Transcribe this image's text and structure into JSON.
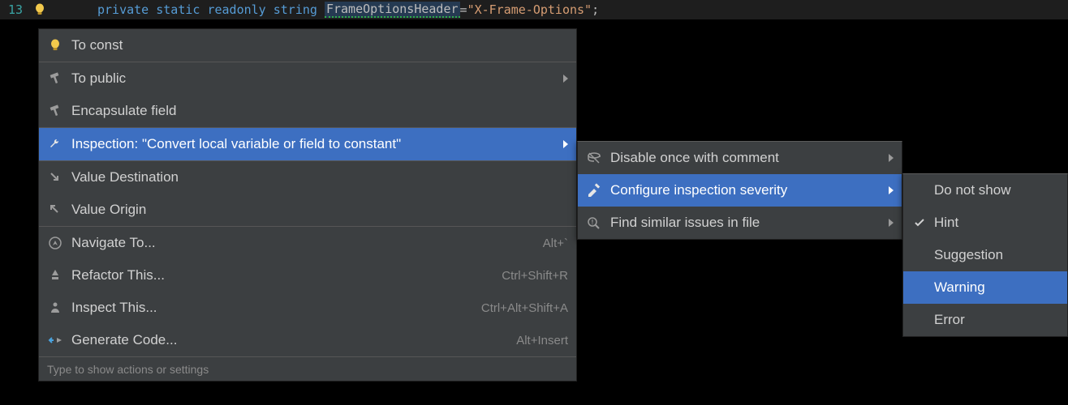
{
  "editor": {
    "line_number": "13",
    "tokens": {
      "private": "private",
      "static": "static",
      "readonly": "readonly",
      "string": "string",
      "ident": "FrameOptionsHeader",
      "equals": " = ",
      "value": "\"X-Frame-Options\"",
      "semi": ";"
    }
  },
  "menu1": {
    "items": [
      {
        "label": "To const",
        "icon": "bulb"
      },
      {
        "label": "To public",
        "icon": "hammer",
        "submenu": true
      },
      {
        "label": "Encapsulate field",
        "icon": "hammer"
      },
      {
        "label": "Inspection: \"Convert local variable or field to constant\"",
        "icon": "wrench",
        "submenu": true,
        "selected": true
      },
      {
        "label": "Value Destination",
        "icon": "arrow-diag-down"
      },
      {
        "label": "Value Origin",
        "icon": "arrow-diag-up"
      },
      {
        "label": "Navigate To...",
        "icon": "compass",
        "shortcut": "Alt+`"
      },
      {
        "label": "Refactor This...",
        "icon": "refactor",
        "shortcut": "Ctrl+Shift+R"
      },
      {
        "label": "Inspect This...",
        "icon": "inspector",
        "shortcut": "Ctrl+Alt+Shift+A"
      },
      {
        "label": "Generate Code...",
        "icon": "generate",
        "shortcut": "Alt+Insert"
      }
    ],
    "footer": "Type to show actions or settings"
  },
  "menu2": {
    "items": [
      {
        "label": "Disable once with comment",
        "icon": "disable",
        "submenu": true
      },
      {
        "label": "Configure inspection severity",
        "icon": "pen-ruler",
        "submenu": true,
        "selected": true
      },
      {
        "label": "Find similar issues in file",
        "icon": "search-error",
        "submenu": true
      }
    ]
  },
  "menu3": {
    "items": [
      {
        "label": "Do not show"
      },
      {
        "label": "Hint",
        "checked": true
      },
      {
        "label": "Suggestion"
      },
      {
        "label": "Warning",
        "selected": true
      },
      {
        "label": "Error"
      }
    ]
  }
}
